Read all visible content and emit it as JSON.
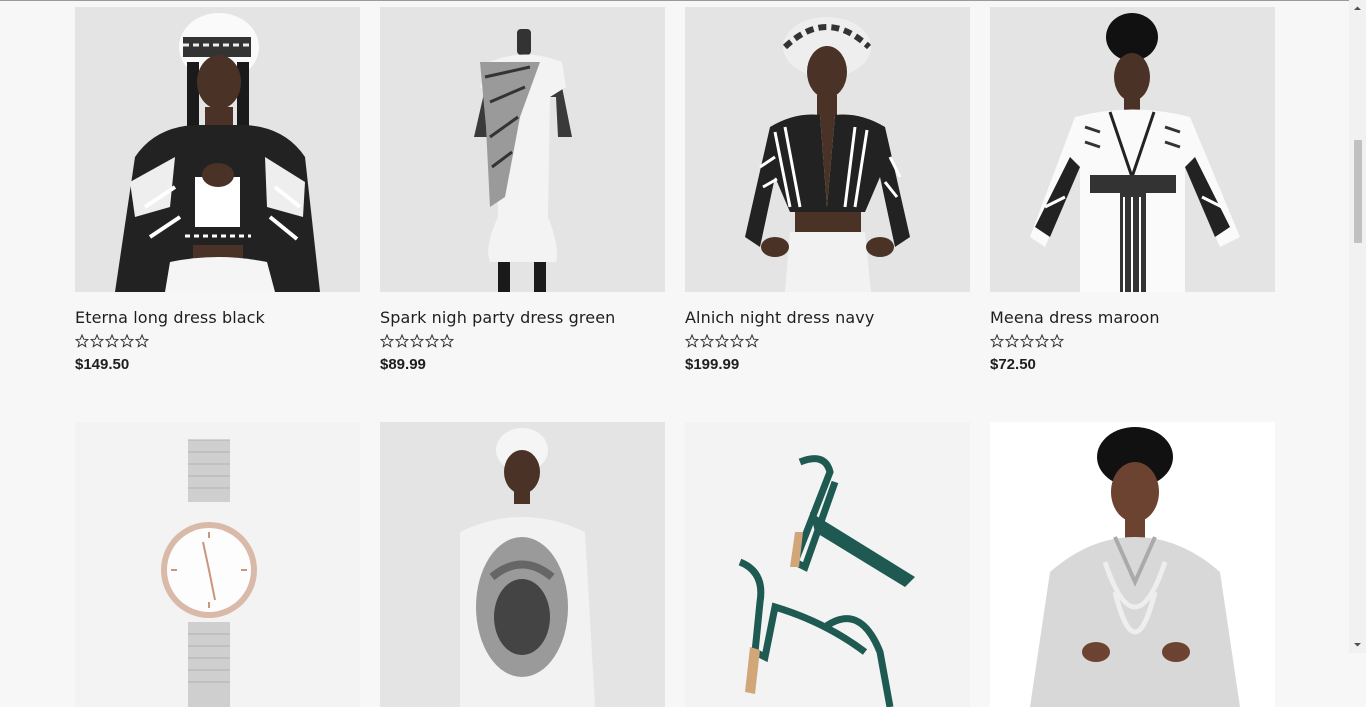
{
  "products": [
    {
      "title": "Eterna long dress black",
      "price": "$149.50",
      "rating": 0,
      "image": "woman-patterned-crop-top-photo"
    },
    {
      "title": "Spark nigh party dress green",
      "price": "$89.99",
      "rating": 0,
      "image": "mannequin-white-dress-photo"
    },
    {
      "title": "Alnich night dress navy",
      "price": "$199.99",
      "rating": 0,
      "image": "woman-striped-jacket-photo"
    },
    {
      "title": "Meena dress maroon",
      "price": "$72.50",
      "rating": 0,
      "image": "woman-white-robe-photo"
    },
    {
      "title": "",
      "price": "",
      "rating": 0,
      "image": "rose-gold-mesh-watch-photo"
    },
    {
      "title": "",
      "price": "",
      "rating": 0,
      "image": "woman-portrait-print-dress-photo"
    },
    {
      "title": "",
      "price": "",
      "rating": 0,
      "image": "green-strappy-heels-photo"
    },
    {
      "title": "",
      "price": "",
      "rating": 0,
      "image": "woman-embroidered-kaftan-photo"
    }
  ],
  "star_icon": "star-outline-icon",
  "colors": {
    "background": "#f7f7f7",
    "thumb_bg": "#e4e4e4",
    "text": "#1e1e1e"
  }
}
